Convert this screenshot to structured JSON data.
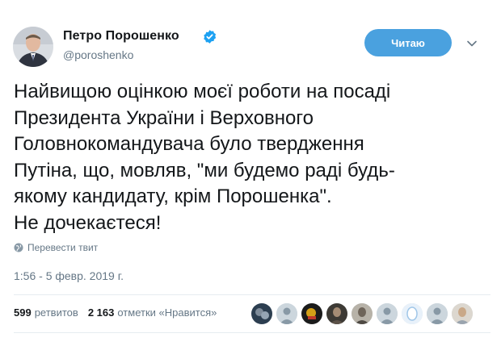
{
  "author": {
    "name": "Петро Порошенко",
    "handle": "@poroshenko",
    "verified": true
  },
  "follow_button": {
    "label": "Читаю"
  },
  "tweet": {
    "lines": [
      "Найвищою оцінкою моєї роботи на посаді",
      "Президента України і Верховного",
      "Головнокомандувача було твердження",
      "Путіна, що, мовляв, \"ми будемо раді будь-",
      "якому кандидату, крім Порошенка\".",
      "Не дочекаєтеся!"
    ]
  },
  "translate": {
    "label": "Перевести твит"
  },
  "timestamp": "1:56 - 5 февр. 2019 г.",
  "stats": {
    "retweets_count": "599",
    "retweets_label": "ретвитов",
    "likes_count": "2 163",
    "likes_label": "отметки «Нравится»"
  },
  "colors": {
    "accent": "#4aa1df",
    "verified": "#1da1f2",
    "muted_text": "#657786",
    "text": "#14171a"
  },
  "icons": [
    "verified-badge-icon",
    "chevron-down-icon",
    "globe-icon"
  ]
}
